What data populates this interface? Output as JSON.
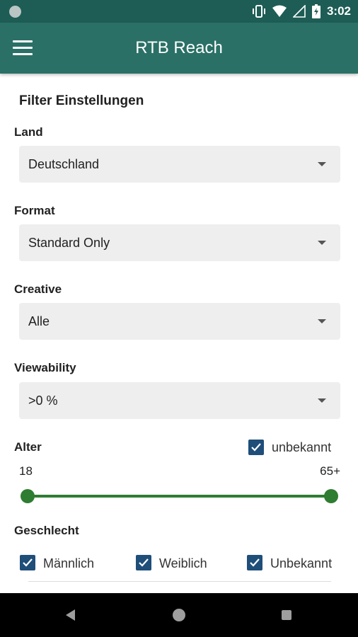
{
  "status_bar": {
    "time": "3:02",
    "icons": [
      "notification-dot-icon",
      "vibrate-icon",
      "wifi-icon",
      "signal-icon",
      "battery-icon"
    ]
  },
  "app_bar": {
    "title": "RTB Reach",
    "menu_icon": "hamburger-menu-icon"
  },
  "filters": {
    "section_title": "Filter Einstellungen",
    "land": {
      "label": "Land",
      "value": "Deutschland"
    },
    "format": {
      "label": "Format",
      "value": "Standard Only"
    },
    "creative": {
      "label": "Creative",
      "value": "Alle"
    },
    "viewability": {
      "label": "Viewability",
      "value": ">0 %"
    },
    "alter": {
      "label": "Alter",
      "unknown_label": "unbekannt",
      "unknown_checked": true,
      "min": "18",
      "max": "65+",
      "range_low_fraction": 0.0,
      "range_high_fraction": 1.0
    },
    "geschlecht": {
      "label": "Geschlecht",
      "options": [
        {
          "label": "Männlich",
          "checked": true
        },
        {
          "label": "Weiblich",
          "checked": true
        },
        {
          "label": "Unbekannt",
          "checked": true
        }
      ]
    }
  },
  "nav_bar": {
    "buttons": [
      "back-icon",
      "home-icon",
      "recents-icon"
    ]
  },
  "colors": {
    "status_bar": "#1d5d55",
    "app_bar": "#2a7066",
    "checkbox": "#1f4e79",
    "slider": "#2e7d32",
    "dropdown_bg": "#eeeeee"
  }
}
